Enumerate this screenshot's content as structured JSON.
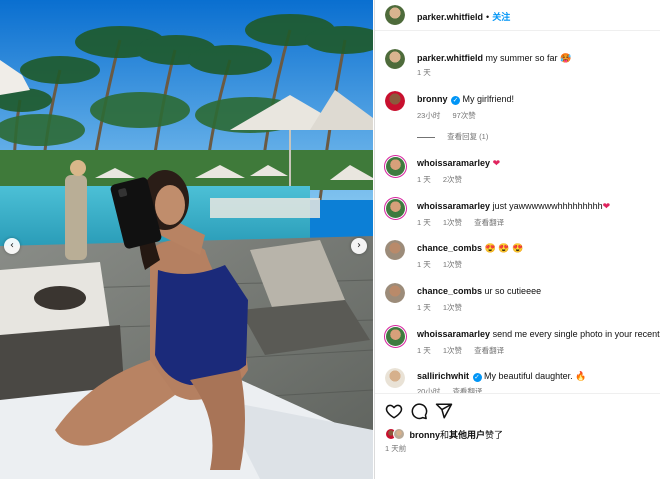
{
  "post": {
    "username": "parker.whitfield",
    "follow": "关注",
    "caption": "my summer so far",
    "caption_emoji": "🥵",
    "caption_time": "1 天"
  },
  "comments": [
    {
      "username": "bronny",
      "verified": true,
      "text": "My girlfriend!",
      "time": "23小时",
      "likes": "97次赞",
      "reply": "",
      "replies_toggle": "查看回复 (1)"
    },
    {
      "username": "whoissaramarley",
      "verified": false,
      "text": "",
      "emoji": "❤",
      "time": "1 天",
      "likes": "2次赞",
      "reply": ""
    },
    {
      "username": "whoissaramarley",
      "verified": false,
      "text": "just yawwwwwwhhhhhhhhh",
      "emoji": "❤",
      "time": "1 天",
      "likes": "1次赞",
      "reply": "查看翻译"
    },
    {
      "username": "chance_combs",
      "verified": false,
      "text": "",
      "emoji": "😍 😍 😍",
      "time": "1 天",
      "likes": "1次赞",
      "reply": ""
    },
    {
      "username": "chance_combs",
      "verified": false,
      "text": "ur so cutieeee",
      "emoji": "",
      "time": "1 天",
      "likes": "1次赞",
      "reply": ""
    },
    {
      "username": "whoissaramarley",
      "verified": false,
      "text": "send me every single photo in your recents.",
      "emoji": "",
      "time": "1 天",
      "likes": "1次赞",
      "reply": "查看翻译"
    },
    {
      "username": "sallirichwhit",
      "verified": true,
      "text": "My beautiful daughter.",
      "emoji": "🔥",
      "time": "20小时",
      "likes": "",
      "reply": "查看翻译"
    }
  ],
  "footer": {
    "liked_by_user": "bronny",
    "liked_by_rest": "和",
    "liked_by_others": "其他用户",
    "liked_by_suffix": "赞了",
    "time": "1 天前"
  },
  "icons": [
    "heart-outline-icon",
    "comment-icon",
    "share-icon",
    "chevron-left-icon",
    "chevron-right-icon",
    "verified-badge-icon"
  ],
  "colors": {
    "accent": "#0095f6",
    "text": "#111111",
    "muted": "#737373",
    "story_ring": "#d6249f"
  }
}
